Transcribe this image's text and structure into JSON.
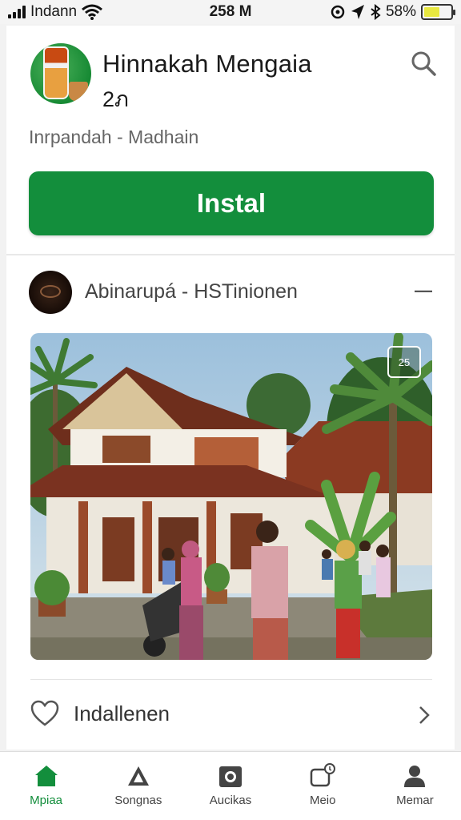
{
  "status_bar": {
    "carrier": "Indann",
    "time": "258 M",
    "battery": "58%",
    "battery_level": 0.58
  },
  "app": {
    "title": "Hinnakah Mengaia",
    "subtitle": "2ภ",
    "description": "Inrpandah - Madhain",
    "install_label": "Instal",
    "accent_color": "#138e3c"
  },
  "post": {
    "channel_name": "Abinarupá - HSTinionen",
    "photo_badge": "25",
    "more_icon": "more-dash-icon"
  },
  "action_row": {
    "label": "Indallenen",
    "icon": "heart-icon"
  },
  "bottom_nav": {
    "items": [
      {
        "label": "Mpiaa",
        "icon": "home-icon",
        "active": true
      },
      {
        "label": "Songnas",
        "icon": "triangle-icon",
        "active": false
      },
      {
        "label": "Aucikas",
        "icon": "camera-icon",
        "active": false
      },
      {
        "label": "Meio",
        "icon": "chat-badge-icon",
        "active": false
      },
      {
        "label": "Memar",
        "icon": "person-icon",
        "active": false
      }
    ]
  }
}
